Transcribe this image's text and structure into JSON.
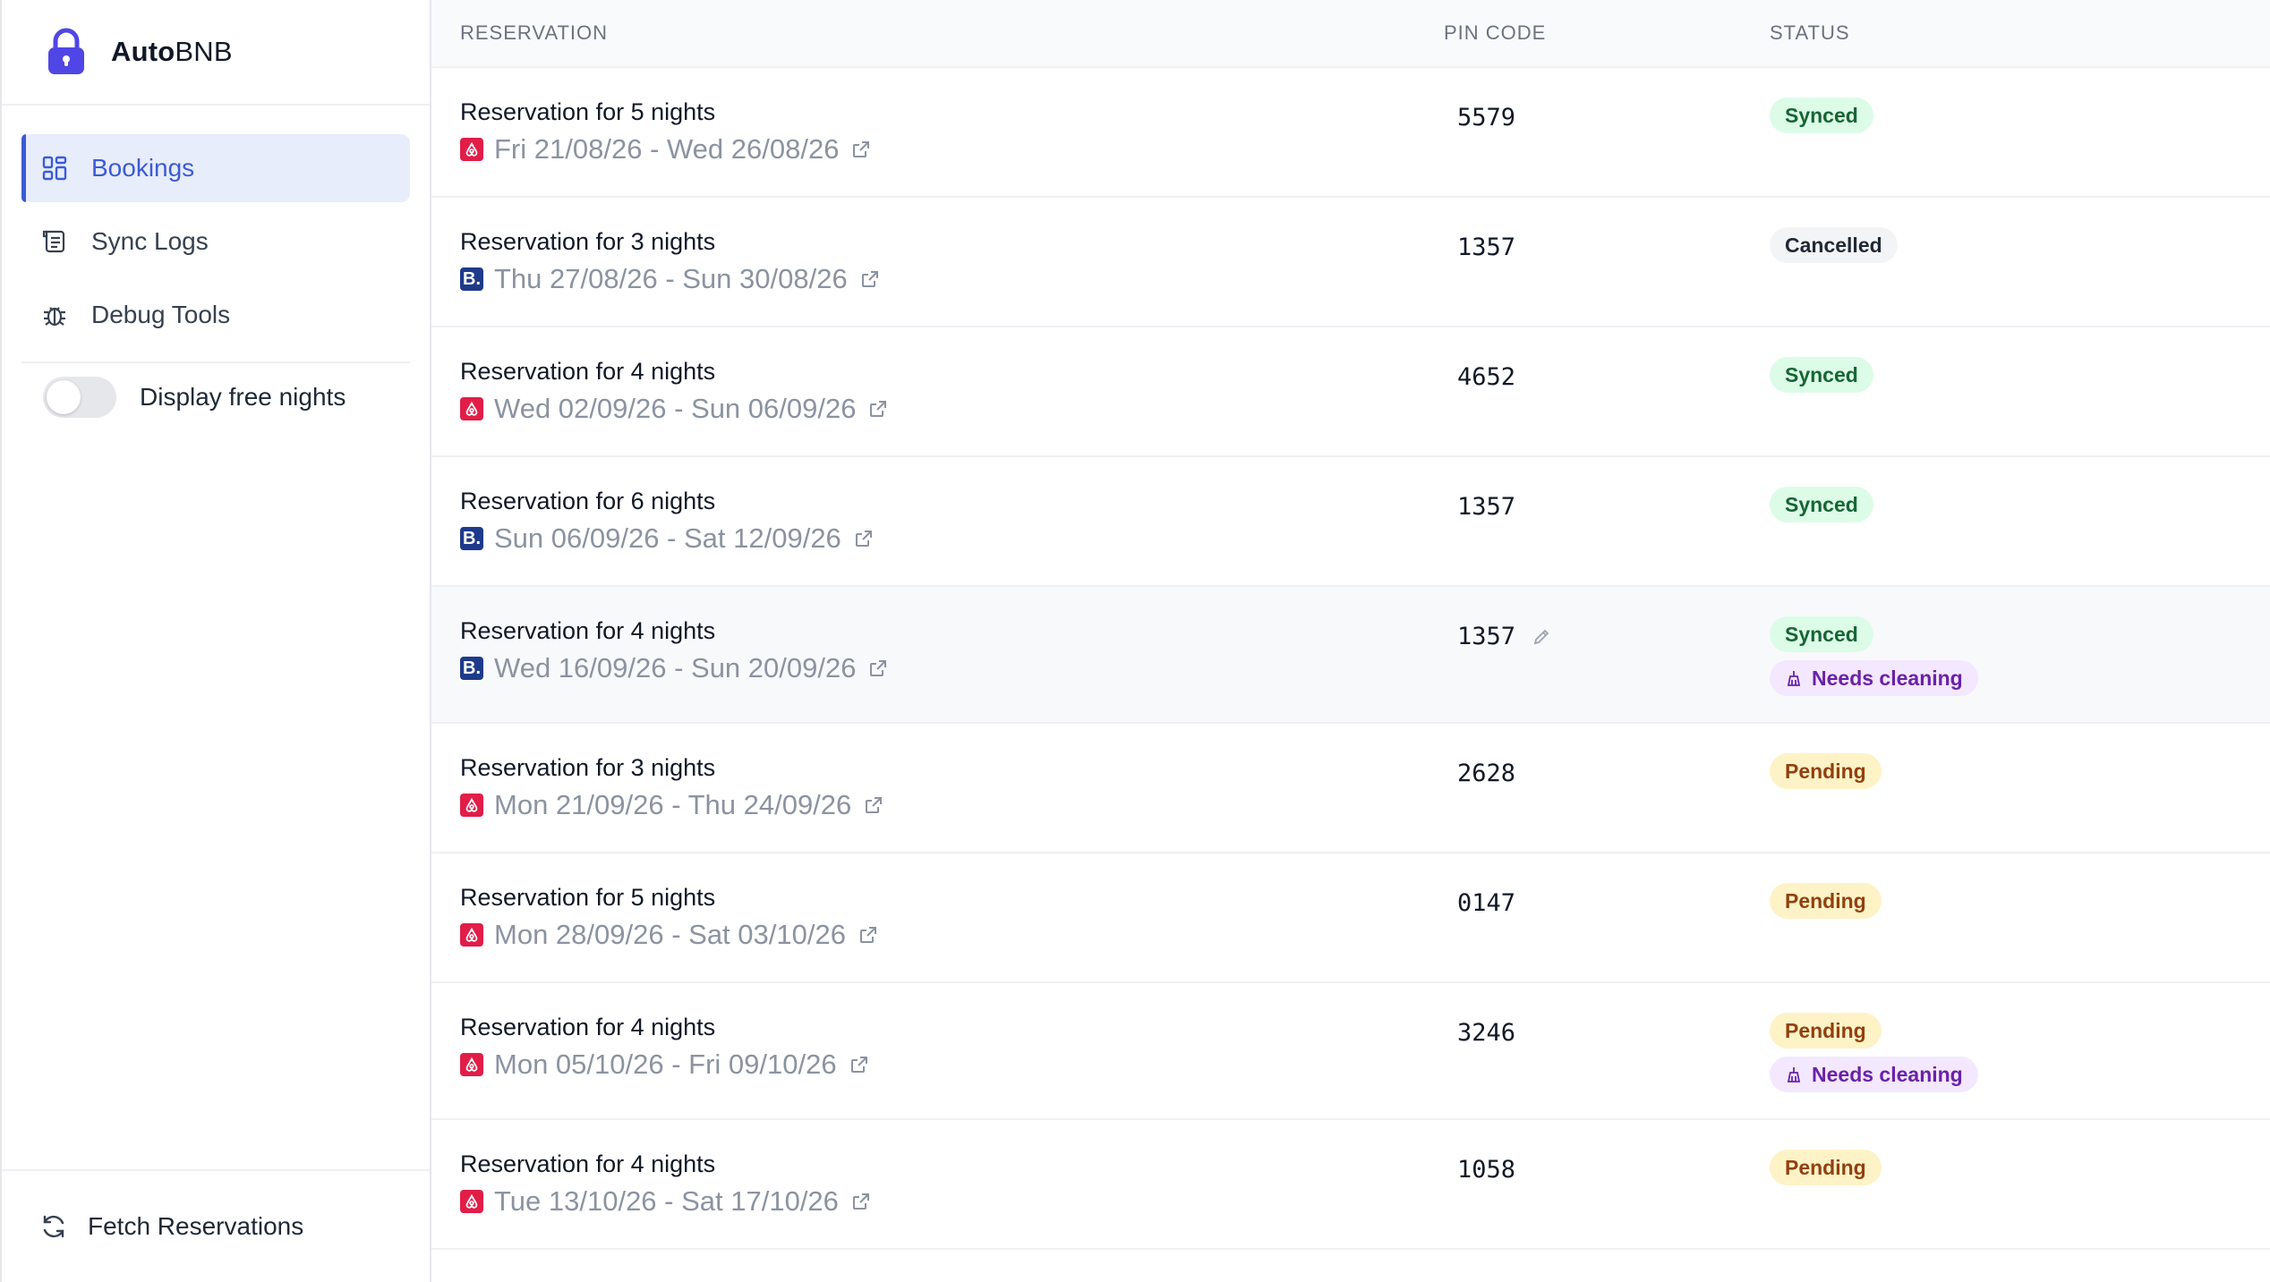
{
  "brand": {
    "name_bold": "Auto",
    "name_light": "BNB"
  },
  "sidebar": {
    "items": [
      {
        "label": "Bookings",
        "icon": "grid-icon",
        "active": true
      },
      {
        "label": "Sync Logs",
        "icon": "log-icon",
        "active": false
      },
      {
        "label": "Debug Tools",
        "icon": "bug-icon",
        "active": false
      }
    ],
    "toggle_label": "Display free nights",
    "toggle_on": false,
    "footer_label": "Fetch Reservations"
  },
  "table": {
    "headers": {
      "reservation": "RESERVATION",
      "pin": "PIN CODE",
      "status": "STATUS"
    },
    "rows": [
      {
        "title": "Reservation for 5 nights",
        "source": "airbnb",
        "dates": "Fri 21/08/26 - Wed 26/08/26",
        "pin": "5579",
        "statuses": [
          "Synced"
        ]
      },
      {
        "title": "Reservation for 3 nights",
        "source": "booking",
        "dates": "Thu 27/08/26 - Sun 30/08/26",
        "pin": "1357",
        "statuses": [
          "Cancelled"
        ]
      },
      {
        "title": "Reservation for 4 nights",
        "source": "airbnb",
        "dates": "Wed 02/09/26 - Sun 06/09/26",
        "pin": "4652",
        "statuses": [
          "Synced"
        ]
      },
      {
        "title": "Reservation for 6 nights",
        "source": "booking",
        "dates": "Sun 06/09/26 - Sat 12/09/26",
        "pin": "1357",
        "statuses": [
          "Synced"
        ]
      },
      {
        "title": "Reservation for 4 nights",
        "source": "booking",
        "dates": "Wed 16/09/26 - Sun 20/09/26",
        "pin": "1357",
        "statuses": [
          "Synced",
          "Needs cleaning"
        ]
      },
      {
        "title": "Reservation for 3 nights",
        "source": "airbnb",
        "dates": "Mon 21/09/26 - Thu 24/09/26",
        "pin": "2628",
        "statuses": [
          "Pending"
        ]
      },
      {
        "title": "Reservation for 5 nights",
        "source": "airbnb",
        "dates": "Mon 28/09/26 - Sat 03/10/26",
        "pin": "0147",
        "statuses": [
          "Pending"
        ]
      },
      {
        "title": "Reservation for 4 nights",
        "source": "airbnb",
        "dates": "Mon 05/10/26 - Fri 09/10/26",
        "pin": "3246",
        "statuses": [
          "Pending",
          "Needs cleaning"
        ]
      },
      {
        "title": "Reservation for 4 nights",
        "source": "airbnb",
        "dates": "Tue 13/10/26 - Sat 17/10/26",
        "pin": "1058",
        "statuses": [
          "Pending"
        ]
      }
    ]
  },
  "colors": {
    "accent": "#3b5bd6",
    "airbnb": "#e11d48",
    "booking": "#1e3a8a",
    "synced_bg": "#dcfce7",
    "pending_bg": "#fef3c7",
    "cleaning_bg": "#f3e8ff"
  }
}
